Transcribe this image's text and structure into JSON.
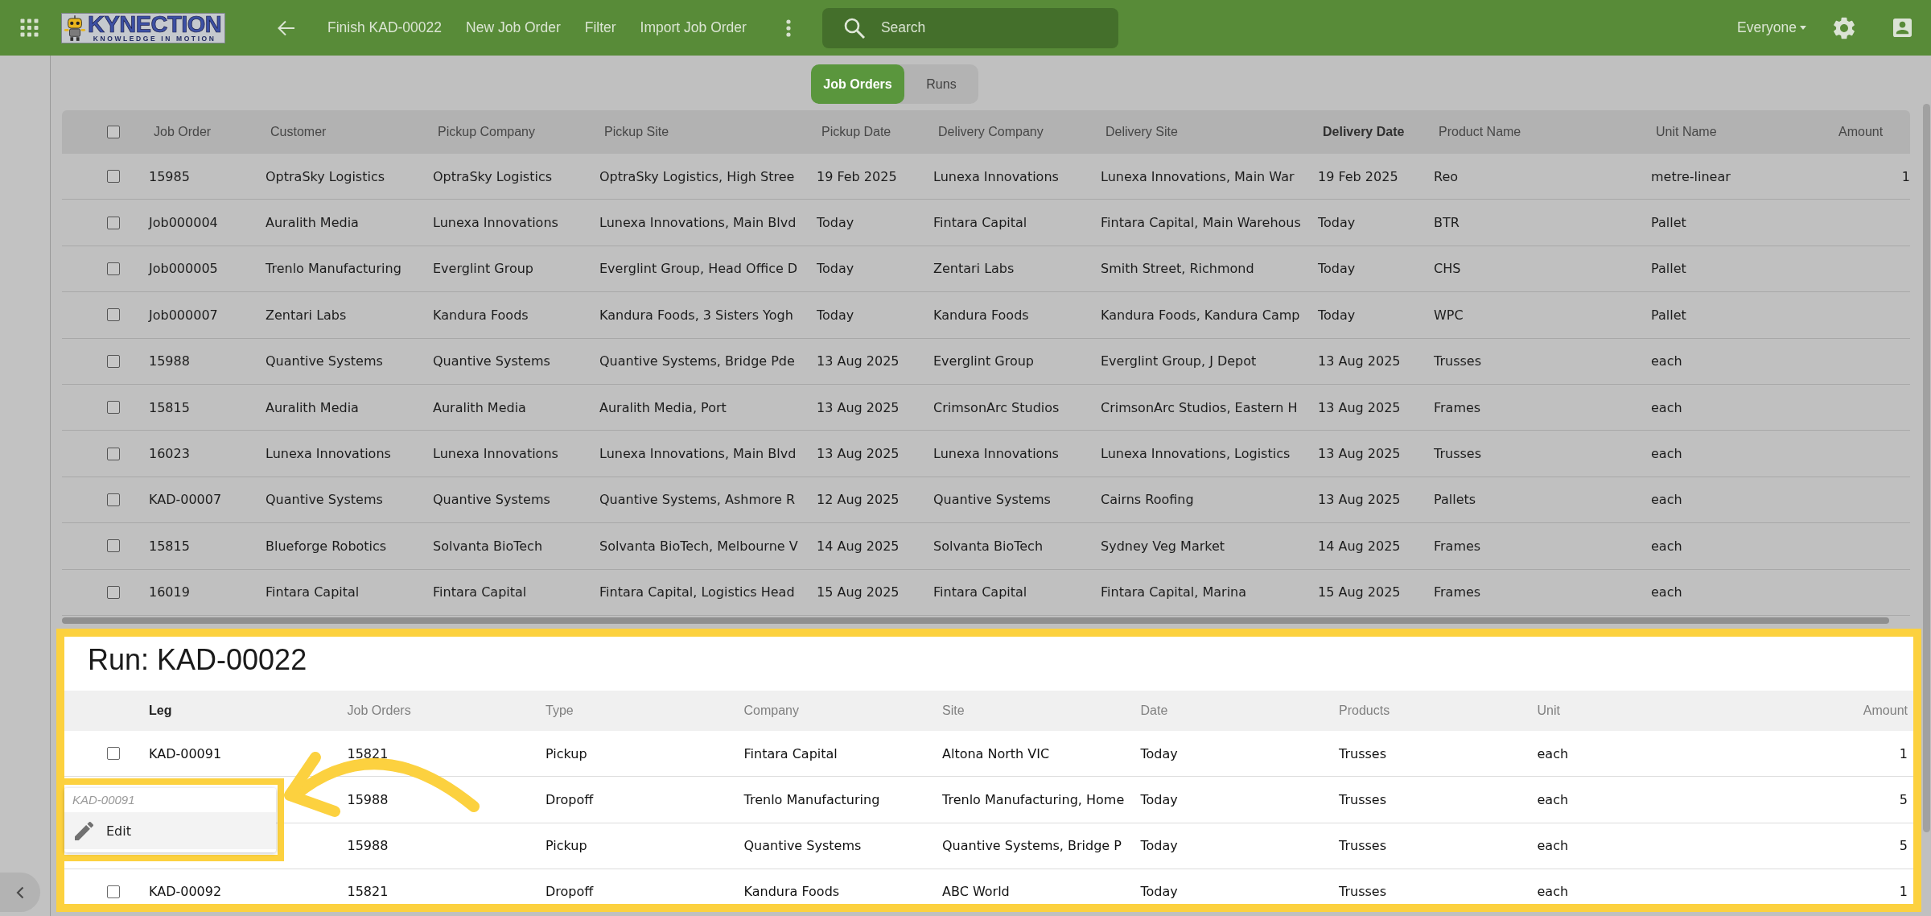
{
  "top_bar": {
    "logo": {
      "wordmark": "KYNECTION",
      "tagline": "KNOWLEDGE IN MOTION"
    },
    "actions": [
      "Finish KAD-00022",
      "New Job Order",
      "Filter",
      "Import Job Order"
    ],
    "search": {
      "placeholder": "Search"
    },
    "audience": "Everyone"
  },
  "view_tabs": [
    {
      "label": "Job Orders",
      "selected": true
    },
    {
      "label": "Runs",
      "selected": false
    }
  ],
  "job_orders": {
    "select_all_checked": false,
    "columns": [
      {
        "label": "Job Order",
        "sorted": false
      },
      {
        "label": "Customer",
        "sorted": false
      },
      {
        "label": "Pickup Company",
        "sorted": false
      },
      {
        "label": "Pickup Site",
        "sorted": false
      },
      {
        "label": "Pickup Date",
        "sorted": false
      },
      {
        "label": "Delivery Company",
        "sorted": false
      },
      {
        "label": "Delivery Site",
        "sorted": false
      },
      {
        "label": "Delivery Date",
        "sorted": true
      },
      {
        "label": "Product Name",
        "sorted": false
      },
      {
        "label": "Unit Name",
        "sorted": false
      },
      {
        "label": "Amount",
        "sorted": false
      }
    ],
    "rows": [
      {
        "checked": false,
        "cells": [
          "15985",
          "OptraSky Logistics",
          "OptraSky Logistics",
          "OptraSky Logistics, High Stree",
          "19 Feb 2025",
          "Lunexa Innovations",
          "Lunexa Innovations, Main War",
          "19 Feb 2025",
          "Reo",
          "metre-linear",
          "1"
        ]
      },
      {
        "checked": false,
        "cells": [
          "Job000004",
          "Auralith Media",
          "Lunexa Innovations",
          "Lunexa Innovations, Main Blvd",
          "Today",
          "Fintara Capital",
          "Fintara Capital, Main Warehous",
          "Today",
          "BTR",
          "Pallet"
        ]
      },
      {
        "checked": false,
        "cells": [
          "Job000005",
          "Trenlo Manufacturing",
          "Everglint Group",
          "Everglint Group, Head Office D",
          "Today",
          "Zentari Labs",
          "Smith Street, Richmond",
          "Today",
          "CHS",
          "Pallet"
        ]
      },
      {
        "checked": false,
        "cells": [
          "Job000007",
          "Zentari Labs",
          "Kandura Foods",
          "Kandura Foods, 3 Sisters Yogh",
          "Today",
          "Kandura Foods",
          "Kandura Foods, Kandura Camp",
          "Today",
          "WPC",
          "Pallet"
        ]
      },
      {
        "checked": false,
        "cells": [
          "15988",
          "Quantive Systems",
          "Quantive Systems",
          "Quantive Systems, Bridge Pde",
          "13 Aug 2025",
          "Everglint Group",
          "Everglint Group, J Depot",
          "13 Aug 2025",
          "Trusses",
          "each"
        ]
      },
      {
        "checked": false,
        "cells": [
          "15815",
          "Auralith Media",
          "Auralith Media",
          "Auralith Media, Port",
          "13 Aug 2025",
          "CrimsonArc Studios",
          "CrimsonArc Studios, Eastern H",
          "13 Aug 2025",
          "Frames",
          "each"
        ]
      },
      {
        "checked": false,
        "cells": [
          "16023",
          "Lunexa Innovations",
          "Lunexa Innovations",
          "Lunexa Innovations, Main Blvd",
          "13 Aug 2025",
          "Lunexa Innovations",
          "Lunexa Innovations, Logistics",
          "13 Aug 2025",
          "Trusses",
          "each"
        ]
      },
      {
        "checked": false,
        "cells": [
          "KAD-00007",
          "Quantive Systems",
          "Quantive Systems",
          "Quantive Systems, Ashmore R",
          "12 Aug 2025",
          "Quantive Systems",
          "Cairns Roofing",
          "13 Aug 2025",
          "Pallets",
          "each"
        ]
      },
      {
        "checked": false,
        "cells": [
          "15815",
          "Blueforge Robotics",
          "Solvanta BioTech",
          "Solvanta BioTech, Melbourne V",
          "14 Aug 2025",
          "Solvanta BioTech",
          "Sydney Veg Market",
          "14 Aug 2025",
          "Frames",
          "each"
        ]
      },
      {
        "checked": false,
        "cells": [
          "16019",
          "Fintara Capital",
          "Fintara Capital",
          "Fintara Capital, Logistics Head",
          "15 Aug 2025",
          "Fintara Capital",
          "Fintara Capital, Marina",
          "15 Aug 2025",
          "Frames",
          "each"
        ]
      }
    ]
  },
  "run_panel": {
    "highlighted": true,
    "title": "Run: KAD-00022",
    "columns": [
      {
        "label": "Leg",
        "sorted": true
      },
      {
        "label": "Job Orders",
        "sorted": false
      },
      {
        "label": "Type",
        "sorted": false
      },
      {
        "label": "Company",
        "sorted": false
      },
      {
        "label": "Site",
        "sorted": false
      },
      {
        "label": "Date",
        "sorted": false
      },
      {
        "label": "Products",
        "sorted": false
      },
      {
        "label": "Unit",
        "sorted": false
      },
      {
        "label": "Amount",
        "sorted": false
      }
    ],
    "rows": [
      {
        "checked": false,
        "leg": "KAD-00091",
        "job_order": "15821",
        "type": "Pickup",
        "company": "Fintara Capital",
        "site": "Altona North VIC",
        "date": "Today",
        "products": "Trusses",
        "unit": "each",
        "amount": "1"
      },
      {
        "job_order": "15988",
        "type": "Dropoff",
        "company": "Trenlo Manufacturing",
        "site": "Trenlo Manufacturing, Home",
        "date": "Today",
        "products": "Trusses",
        "unit": "each",
        "amount": "5"
      },
      {
        "job_order": "15988",
        "type": "Pickup",
        "company": "Quantive Systems",
        "site": "Quantive Systems, Bridge P",
        "date": "Today",
        "products": "Trusses",
        "unit": "each",
        "amount": "5"
      },
      {
        "checked": false,
        "leg": "KAD-00092",
        "job_order": "15821",
        "type": "Dropoff",
        "company": "Kandura Foods",
        "site": "ABC World",
        "date": "Today",
        "products": "Trusses",
        "unit": "each",
        "amount": "1"
      }
    ]
  },
  "context_menu": {
    "highlighted": true,
    "heading": "KAD-00091",
    "items": [
      {
        "label": "Edit",
        "highlighted": true
      }
    ]
  }
}
